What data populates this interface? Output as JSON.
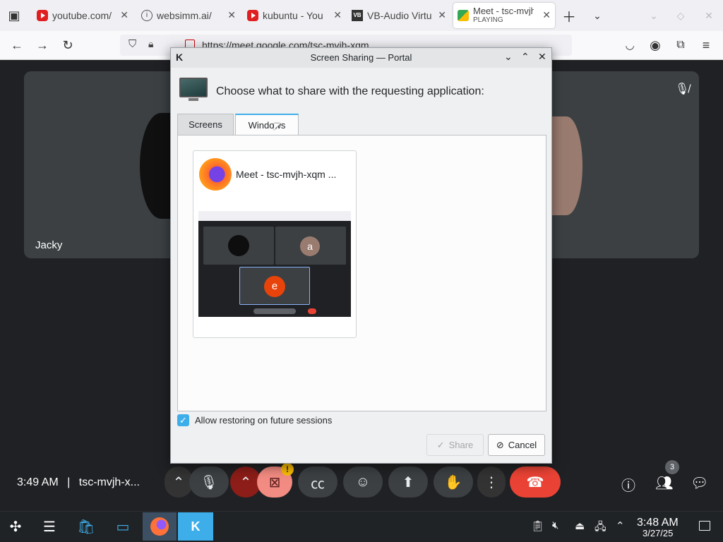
{
  "browser": {
    "tabs": [
      {
        "title": "youtube.com/",
        "favicon": "youtube-icon"
      },
      {
        "title": "websimm.ai/",
        "favicon": "info-icon"
      },
      {
        "title": "kubuntu - You",
        "favicon": "youtube-icon"
      },
      {
        "title": "VB-Audio Virtu",
        "favicon": "vb-icon"
      },
      {
        "title": "Meet - tsc-mvjh",
        "subtitle": "PLAYING",
        "favicon": "meet-icon"
      }
    ],
    "url": "https://meet.google.com/tsc-mvjh-xqm"
  },
  "meet": {
    "participant_name": "Jacky",
    "time": "3:49 AM",
    "meeting_code": "tsc-mvjh-x...",
    "participant_count": "3",
    "camera_alert": "!"
  },
  "dialog": {
    "title": "Screen Sharing — Portal",
    "heading": "Choose what to share with the requesting application:",
    "tabs": {
      "screens": "Screens",
      "windows": "Windows"
    },
    "windows": [
      {
        "title": "Meet - tsc-mvjh-xqm ...",
        "thumb_letters": [
          "a",
          "e"
        ]
      }
    ],
    "restore_label": "Allow restoring on future sessions",
    "restore_checked": true,
    "share_label": "Share",
    "cancel_label": "Cancel"
  },
  "taskbar": {
    "time": "3:48 AM",
    "date": "3/27/25"
  },
  "colors": {
    "accent": "#3daee9",
    "meet_bg": "#202124",
    "end_call": "#ea4335"
  }
}
